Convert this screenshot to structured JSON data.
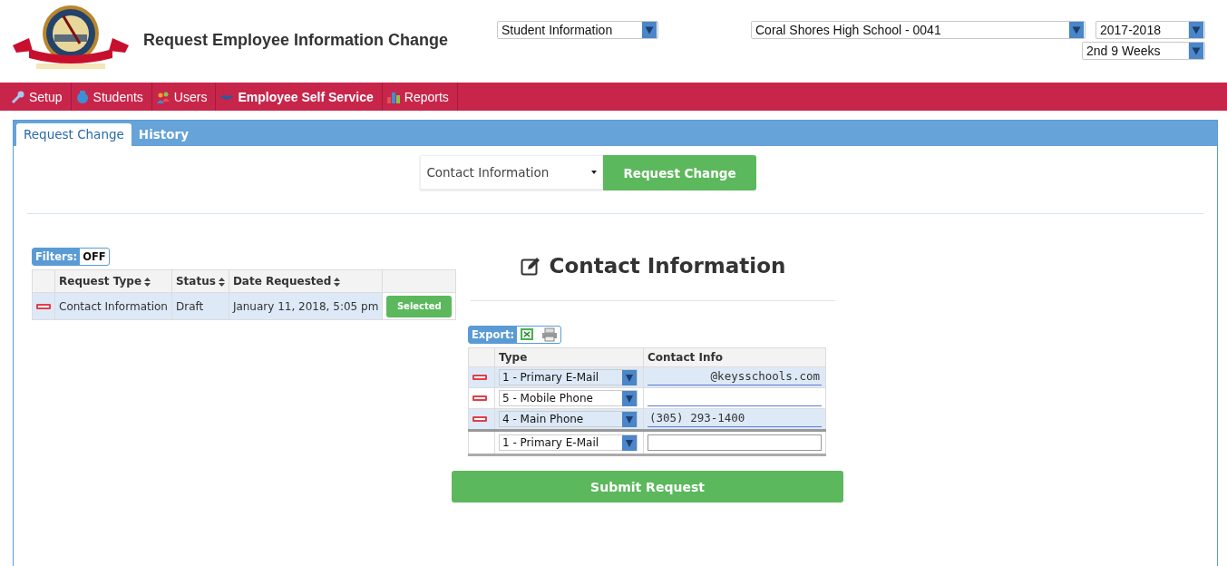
{
  "header": {
    "title": "Request Employee Information Change",
    "module_select": "Student Information",
    "school_select": "Coral Shores High School - 0041",
    "year_select": "2017-2018",
    "term_select": "2nd 9 Weeks"
  },
  "nav": [
    {
      "label": "Setup",
      "selected": false
    },
    {
      "label": "Students",
      "selected": false
    },
    {
      "label": "Users",
      "selected": false
    },
    {
      "label": "Employee Self Service",
      "selected": true
    },
    {
      "label": "Reports",
      "selected": false
    }
  ],
  "tabs": [
    {
      "label": "Request Change",
      "selected": true
    },
    {
      "label": "History",
      "selected": false
    }
  ],
  "request_form": {
    "type_select": "Contact Information",
    "button": "Request Change"
  },
  "filters": {
    "label": "Filters:",
    "value": "OFF"
  },
  "requests_table": {
    "columns": [
      "Request Type",
      "Status",
      "Date Requested"
    ],
    "rows": [
      {
        "request_type": "Contact Information",
        "status": "Draft",
        "date_requested": "January 11, 2018, 5:05 pm",
        "action": "Selected"
      }
    ]
  },
  "contact": {
    "title": "Contact Information",
    "export_label": "Export:",
    "columns": [
      "Type",
      "Contact Info"
    ],
    "rows": [
      {
        "kind": "existing",
        "type": "1 - Primary E-Mail",
        "value": "@keysschools.com"
      },
      {
        "kind": "existing",
        "type": "5 - Mobile Phone"
      },
      {
        "kind": "existing",
        "type": "4 - Main Phone",
        "value": "(305) 293-1400"
      },
      {
        "kind": "new",
        "type": "1 - Primary E-Mail"
      }
    ],
    "submit": "Submit Request"
  }
}
